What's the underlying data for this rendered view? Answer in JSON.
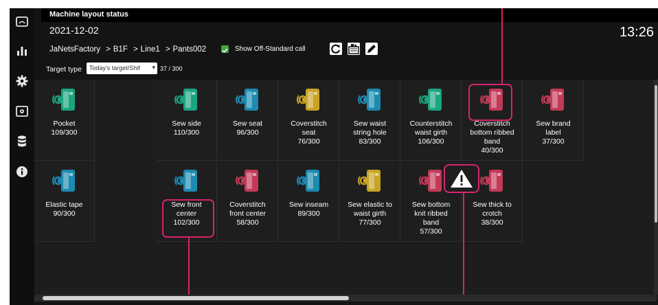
{
  "header": {
    "title": "Machine layout status",
    "date": "2021-12-02",
    "clock": "13:26",
    "breadcrumb": [
      "JaNetsFactory",
      "B1F",
      "Line1",
      "Pants002"
    ],
    "breadcrumb_separator": ">",
    "show_off_standard_label": "Show Off-Standard call"
  },
  "filter": {
    "target_type_label": "Target type",
    "target_select_value": "Today's target/Shif",
    "count": "37 / 300"
  },
  "sidebar": {
    "icons": [
      "monitor-icon",
      "bar-chart-icon",
      "gear-icon",
      "screen-settings-icon",
      "database-icon",
      "info-icon"
    ]
  },
  "colors": {
    "green": "#1aa57f",
    "blue": "#1d8ab0",
    "yellow": "#c8a425",
    "red": "#c23a57",
    "highlight": "#d6246e"
  },
  "cards": [
    {
      "lines": [
        "Pocket",
        "109/300"
      ],
      "color": "green"
    },
    {
      "lines": [
        "Sew side",
        "110/300"
      ],
      "color": "green"
    },
    {
      "lines": [
        "Sew seat",
        "96/300"
      ],
      "color": "blue"
    },
    {
      "lines": [
        "Coverstitch",
        "seat",
        "76/300"
      ],
      "color": "yellow"
    },
    {
      "lines": [
        "Sew waist",
        "string hole",
        "83/300"
      ],
      "color": "blue"
    },
    {
      "lines": [
        "Counterstitch",
        "waist girth",
        "106/300"
      ],
      "color": "green"
    },
    {
      "lines": [
        "Coverstitch",
        "bottom ribbed",
        "band",
        "40/300"
      ],
      "color": "red"
    },
    {
      "lines": [
        "Sew brand",
        "label",
        "37/300"
      ],
      "color": "red"
    },
    {
      "lines": [
        "Elastic tape",
        "90/300"
      ],
      "color": "blue"
    },
    {
      "lines": [
        "Sew front",
        "center",
        "102/300"
      ],
      "color": "blue"
    },
    {
      "lines": [
        "Coverstitch",
        "front center",
        "58/300"
      ],
      "color": "red"
    },
    {
      "lines": [
        "Sew inseam",
        "89/300"
      ],
      "color": "blue"
    },
    {
      "lines": [
        "Sew elastic to",
        "waist girth",
        "77/300"
      ],
      "color": "yellow"
    },
    {
      "lines": [
        "Sew bottom",
        "knit ribbed",
        "band",
        "57/300"
      ],
      "color": "red"
    },
    {
      "lines": [
        "Sew thick to",
        "crotch",
        "38/300"
      ],
      "color": "red"
    }
  ]
}
